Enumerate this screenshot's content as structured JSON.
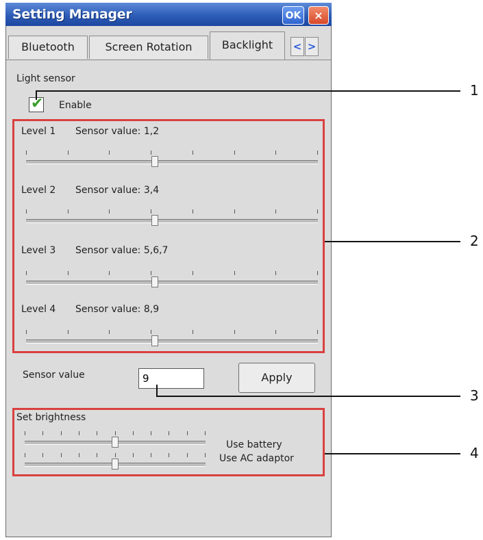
{
  "window": {
    "title": "Setting Manager",
    "ok_label": "OK",
    "close_label": "×"
  },
  "tabs": [
    {
      "label": "Bluetooth"
    },
    {
      "label": "Screen Rotation"
    },
    {
      "label": "Backlight"
    }
  ],
  "tab_nav": {
    "left": "<",
    "right": ">"
  },
  "light_sensor": {
    "group_label": "Light sensor",
    "enable_label": "Enable",
    "enabled": true,
    "levels": [
      {
        "label": "Level 1",
        "sensor_text": "Sensor value: 1,2",
        "value_fraction": 0.44
      },
      {
        "label": "Level 2",
        "sensor_text": "Sensor value: 3,4",
        "value_fraction": 0.44
      },
      {
        "label": "Level 3",
        "sensor_text": "Sensor value: 5,6,7",
        "value_fraction": 0.44
      },
      {
        "label": "Level 4",
        "sensor_text": "Sensor value: 8,9",
        "value_fraction": 0.44
      }
    ]
  },
  "sensor": {
    "label": "Sensor value",
    "value": "9",
    "apply_label": "Apply"
  },
  "brightness": {
    "group_label": "Set brightness",
    "battery_label": "Use battery",
    "ac_label": "Use AC adaptor",
    "battery_fraction": 0.5,
    "ac_fraction": 0.5
  },
  "callouts": [
    "1",
    "2",
    "3",
    "4"
  ],
  "colors": {
    "title_blue": "#2d5cb7",
    "highlight_red": "#d9403f",
    "check_green": "#3a9d2c"
  }
}
